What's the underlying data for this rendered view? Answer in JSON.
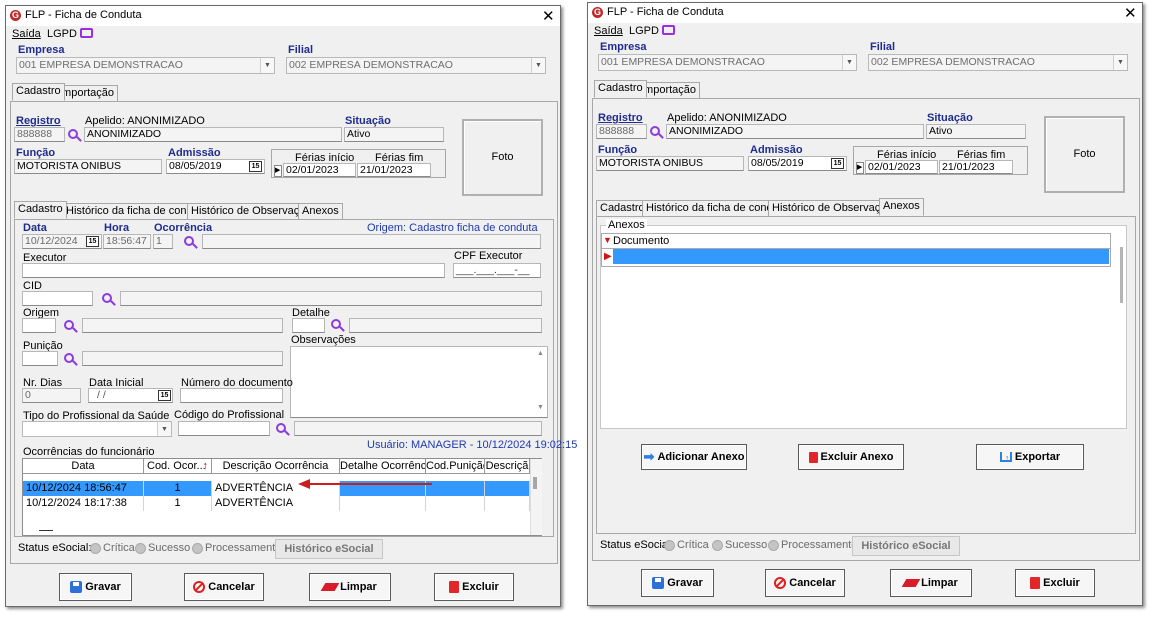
{
  "colors": {
    "accent": "#1f2c8f",
    "logo": "#c0282a",
    "search_icon": "#8d3be0",
    "selection": "#3399ff",
    "arrow": "#cc1e1e"
  },
  "window": {
    "title": "FLP - Ficha de Conduta",
    "close": "✕",
    "menu_saida": "Saída",
    "menu_lgpd": "LGPD"
  },
  "empresa": {
    "label": "Empresa",
    "value": "001 EMPRESA DEMONSTRACAO"
  },
  "filial": {
    "label": "Filial",
    "value": "002 EMPRESA DEMONSTRACAO"
  },
  "top_tabs": [
    "Cadastro",
    "Importação"
  ],
  "registro": {
    "label": "Registro",
    "value": "888888"
  },
  "apelido": {
    "label": "Apelido: ANONIMIZADO",
    "value": "ANONIMIZADO"
  },
  "situacao": {
    "label": "Situação",
    "value": "Ativo"
  },
  "funcao": {
    "label": "Função",
    "value": "MOTORISTA ONIBUS"
  },
  "admissao": {
    "label": "Admissão",
    "value": "08/05/2019"
  },
  "ferias": {
    "inicio_label": "Férias início",
    "fim_label": "Férias fim",
    "inicio": "02/01/2023",
    "fim": "21/01/2023"
  },
  "foto": "Foto",
  "inner_tabs": [
    "Cadastro",
    "Histórico da ficha de conduta",
    "Histórico de Observações",
    "Anexos"
  ],
  "cad": {
    "data_label": "Data",
    "data_value": "10/12/2024",
    "hora_label": "Hora",
    "hora_value": "18:56:47",
    "ocorrencia_label": "Ocorrência",
    "ocorrencia_value": "1",
    "origem_note": "Origem: Cadastro ficha de conduta",
    "executor_label": "Executor",
    "cpf_label": "CPF Executor",
    "cpf_mask": "___.___.___-__",
    "cid_label": "CID",
    "origem_label": "Origem",
    "detalhe_label": "Detalhe",
    "punicao_label": "Punição",
    "observacoes_label": "Observações",
    "nr_dias_label": "Nr. Dias",
    "nr_dias_value": "0",
    "data_inicial_label": "Data Inicial",
    "data_inicial_value": "/ /",
    "num_doc_label": "Número do documento",
    "tipo_prof_label": "Tipo do Profissional da Saúde",
    "cod_prof_label": "Código do Profissional",
    "ocorr_func_label": "Ocorrências do funcionário",
    "usuario_note": "Usuário: MANAGER - 10/12/2024 19:02:15",
    "grid_headers": [
      "Data",
      "Cod. Ocor...",
      "Descrição Ocorrência",
      "Detalhe Ocorrência",
      "Cod.Punição",
      "Descriçã"
    ],
    "rows": [
      {
        "data": "10/12/2024 18:56:47",
        "cod": "1",
        "desc": "ADVERTÊNCIA",
        "selected": true
      },
      {
        "data": "10/12/2024 18:17:38",
        "cod": "1",
        "desc": "ADVERTÊNCIA",
        "selected": false
      }
    ]
  },
  "anexos": {
    "group_label": "Anexos",
    "header": "Documento",
    "add": "Adicionar Anexo",
    "del": "Excluir Anexo",
    "export": "Exportar"
  },
  "status": {
    "label": "Status eSocial:",
    "critica": "Crítica",
    "sucesso": "Sucesso",
    "processamento": "Processamento",
    "historico": "Histórico eSocial"
  },
  "buttons": {
    "gravar": "Gravar",
    "cancelar": "Cancelar",
    "limpar": "Limpar",
    "excluir": "Excluir"
  }
}
